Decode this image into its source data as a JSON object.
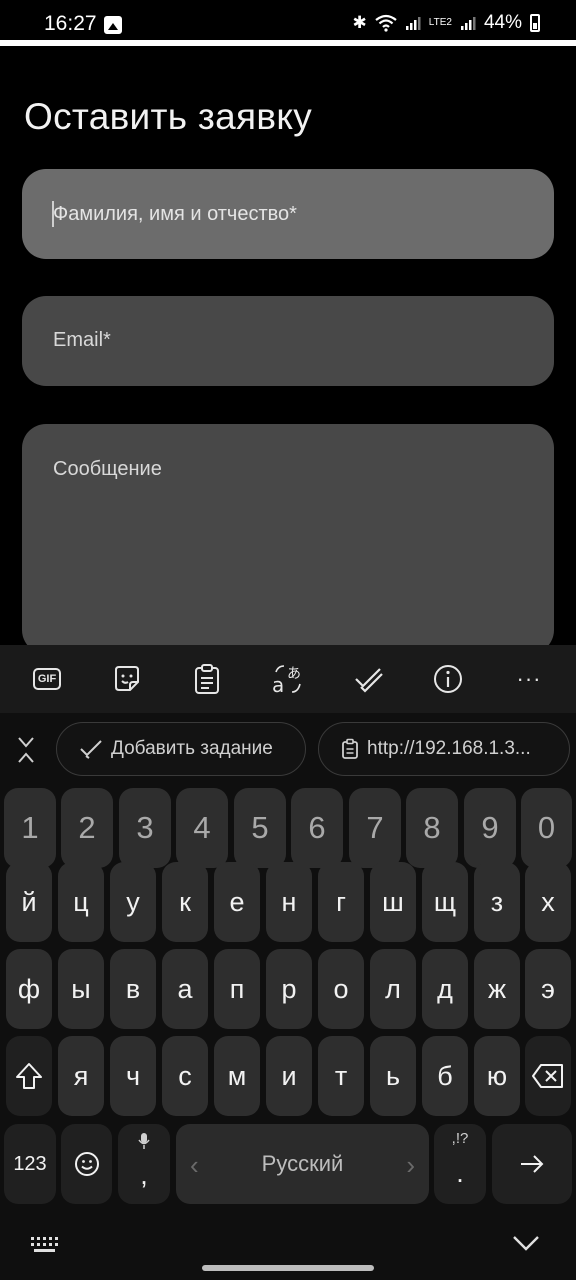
{
  "status_bar": {
    "time": "16:27",
    "battery": "44%",
    "network": "LTE2"
  },
  "form": {
    "title": "Оставить заявку",
    "name_placeholder": "Фамилия, имя и отчество*",
    "email_placeholder": "Email*",
    "message_placeholder": "Сообщение"
  },
  "keyboard": {
    "toolbar": {
      "gif": "GIF",
      "more": "···"
    },
    "suggestions": {
      "task": "Добавить задание",
      "url": "http://192.168.1.3..."
    },
    "rows": {
      "numbers": [
        "1",
        "2",
        "3",
        "4",
        "5",
        "6",
        "7",
        "8",
        "9",
        "0"
      ],
      "row1": [
        "й",
        "ц",
        "у",
        "к",
        "е",
        "н",
        "г",
        "ш",
        "щ",
        "з",
        "х"
      ],
      "row2": [
        "ф",
        "ы",
        "в",
        "а",
        "п",
        "р",
        "о",
        "л",
        "д",
        "ж",
        "э"
      ],
      "row3": [
        "я",
        "ч",
        "с",
        "м",
        "и",
        "т",
        "ь",
        "б",
        "ю"
      ]
    },
    "bottom": {
      "mode_label": "123",
      "comma": ",",
      "space_label": "Русский",
      "period": ".",
      "punct_hint": ",!?"
    }
  }
}
